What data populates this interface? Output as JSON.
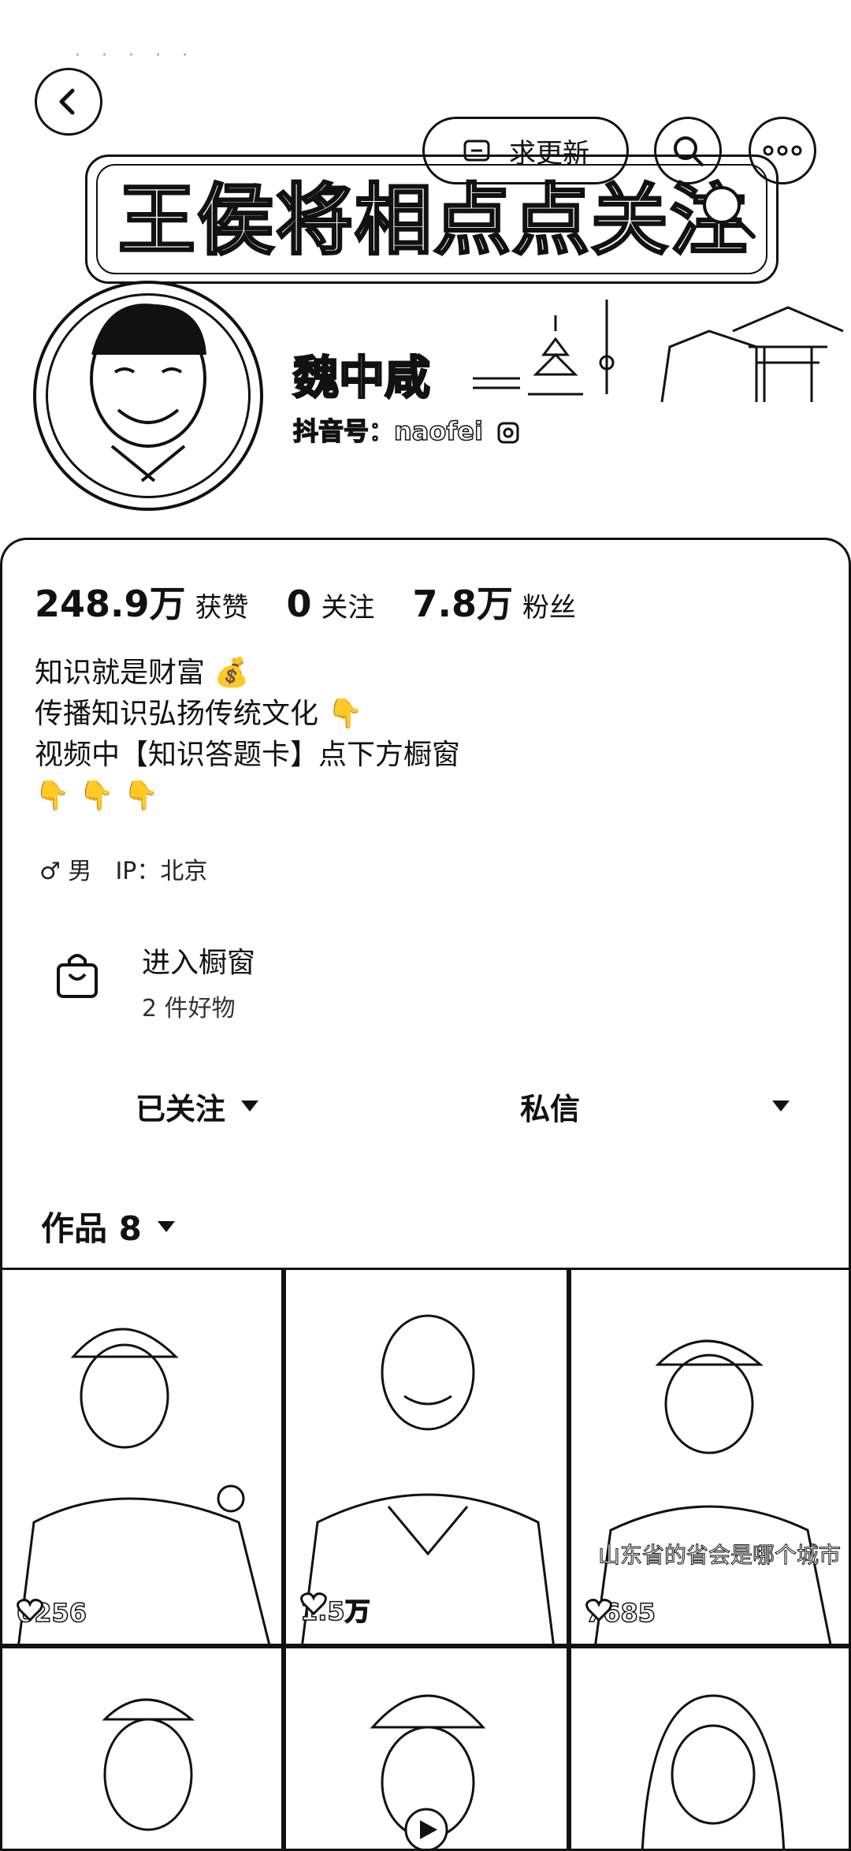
{
  "header": {
    "back_icon": "chevron-left-icon",
    "update_button_label": "求更新",
    "search_icon": "search-icon",
    "more_icon": "more-icon",
    "banner_text": "王侯将相点点关注"
  },
  "profile": {
    "name": "魏中咸",
    "douyin_id": "抖音号：naofei"
  },
  "stats": [
    {
      "value": "248.9万",
      "label": "获赞"
    },
    {
      "value": "0",
      "label": "关注"
    },
    {
      "value": "7.8万",
      "label": "粉丝"
    }
  ],
  "bio": {
    "line1": "知识就是财富 💰",
    "line2": "传播知识弘扬传统文化 👇",
    "line3": "视频中【知识答题卡】点下方橱窗",
    "line4": "👇 👇 👇"
  },
  "meta": {
    "gender": "♂ 男",
    "ip": "IP：北京"
  },
  "shop": {
    "title": "进入橱窗",
    "subtitle": "2 件好物"
  },
  "actions": {
    "follow_label": "已关注",
    "message_label": "私信"
  },
  "works": {
    "tab_label": "作品 8"
  },
  "videos": [
    {
      "likes": "6256"
    },
    {
      "likes": "1.5万"
    },
    {
      "likes": "7685",
      "caption": "山东省的省会是哪个城市"
    },
    {
      "likes": ""
    },
    {
      "likes": ""
    },
    {
      "likes": ""
    }
  ]
}
